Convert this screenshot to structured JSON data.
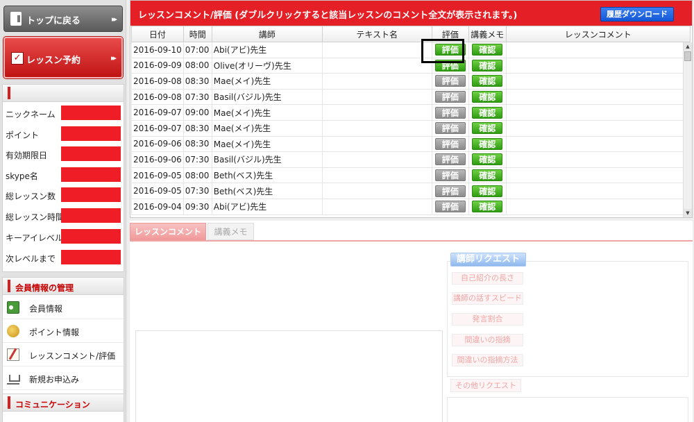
{
  "sidebar": {
    "top_back_label": "トップに戻る",
    "lesson_reserve_label": "レッスン予約",
    "arrows": "▸▸",
    "profile_fields": [
      {
        "label": "ニックネーム"
      },
      {
        "label": "ポイント"
      },
      {
        "label": "有効期限日"
      },
      {
        "label": "skype名"
      },
      {
        "label": "総レッスン数"
      },
      {
        "label": "総レッスン時間"
      },
      {
        "label": "キーアイレベル"
      },
      {
        "label": "次レベルまで"
      }
    ],
    "member_section_title": "会員情報の管理",
    "member_menu": [
      {
        "label": "会員情報",
        "icon": "member-card-icon"
      },
      {
        "label": "ポイント情報",
        "icon": "coins-icon"
      },
      {
        "label": "レッスンコメント/評価",
        "icon": "notepad-icon"
      },
      {
        "label": "新規お申込み",
        "icon": "cart-icon"
      }
    ],
    "communication_title": "コミュニケーション"
  },
  "main": {
    "title": "レッスンコメント/評価 (ダブルクリックすると該当レッスンのコメント全文が表示されます。)",
    "download_button": "履歴ダウンロード",
    "columns": [
      "日付",
      "時間",
      "講師",
      "テキスト名",
      "評価",
      "講義メモ",
      "レッスンコメント"
    ],
    "eval_label": "評価",
    "memo_label": "確認",
    "rows": [
      {
        "date": "2016-09-10",
        "time": "07:00",
        "teacher": "Abi(アビ)先生",
        "text": "",
        "eval_active": true,
        "comment": ""
      },
      {
        "date": "2016-09-09",
        "time": "08:00",
        "teacher": "Olive(オリーヴ)先生",
        "text": "",
        "eval_active": true,
        "comment": ""
      },
      {
        "date": "2016-09-08",
        "time": "08:30",
        "teacher": "Mae(メイ)先生",
        "text": "",
        "eval_active": false,
        "comment": ""
      },
      {
        "date": "2016-09-08",
        "time": "07:30",
        "teacher": "Basil(バジル)先生",
        "text": "",
        "eval_active": false,
        "comment": ""
      },
      {
        "date": "2016-09-07",
        "time": "09:00",
        "teacher": "Mae(メイ)先生",
        "text": "",
        "eval_active": false,
        "comment": ""
      },
      {
        "date": "2016-09-07",
        "time": "08:30",
        "teacher": "Mae(メイ)先生",
        "text": "",
        "eval_active": false,
        "comment": ""
      },
      {
        "date": "2016-09-06",
        "time": "08:30",
        "teacher": "Mae(メイ)先生",
        "text": "",
        "eval_active": false,
        "comment": ""
      },
      {
        "date": "2016-09-06",
        "time": "07:30",
        "teacher": "Basil(バジル)先生",
        "text": "",
        "eval_active": false,
        "comment": ""
      },
      {
        "date": "2016-09-05",
        "time": "08:00",
        "teacher": "Beth(ベス)先生",
        "text": "",
        "eval_active": false,
        "comment": ""
      },
      {
        "date": "2016-09-05",
        "time": "07:30",
        "teacher": "Beth(ベス)先生",
        "text": "",
        "eval_active": false,
        "comment": ""
      },
      {
        "date": "2016-09-04",
        "time": "09:30",
        "teacher": "Abi(アビ)先生",
        "text": "",
        "eval_active": false,
        "comment": ""
      }
    ]
  },
  "bottom": {
    "tabs": [
      "レッスンコメント",
      "講義メモ"
    ],
    "active_tab": "レッスンコメント",
    "teacher_request_title": "講師リクエスト",
    "request_items": [
      "自己紹介の長さ",
      "講師の話すスピード",
      "発言割合",
      "間違いの指摘",
      "間違いの指摘方法"
    ],
    "other_request": "その他リクエスト"
  },
  "colors": {
    "brand_red": "#e41f26",
    "green_button": "#3fb01c",
    "gray_button": "#999999",
    "download_blue": "#1f66e0"
  }
}
